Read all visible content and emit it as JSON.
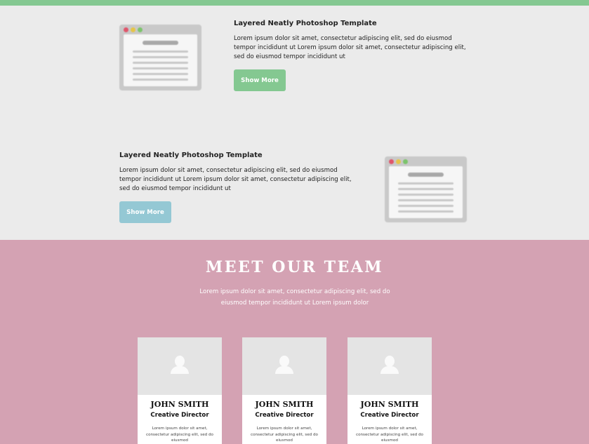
{
  "features": [
    {
      "title": "Layered Neatly Photoshop Template",
      "body": "Lorem ipsum dolor sit amet, consectetur adipiscing elit, sed do eiusmod tempor incididunt ut Lorem ipsum dolor sit amet, consectetur adipiscing elit, sed do eiusmod tempor incididunt ut",
      "button_label": "Show More",
      "button_color": "#84c891"
    },
    {
      "title": "Layered Neatly Photoshop Template",
      "body": "Lorem ipsum dolor sit amet, consectetur adipiscing elit, sed do eiusmod tempor incididunt ut Lorem ipsum dolor sit amet, consectetur adipiscing elit, sed do eiusmod tempor incididunt ut",
      "button_label": "Show More",
      "button_color": "#94c8d4"
    }
  ],
  "team": {
    "heading": "MEET OUR TEAM",
    "subtitle": "Lorem ipsum dolor sit amet, consectetur adipiscing elit, sed do eiusmod tempor incididunt ut Lorem ipsum dolor",
    "members": [
      {
        "name": "JOHN SMITH",
        "role": "Creative Director",
        "bio": "Lorem ipsum dolor sit amet, consectetur adipiscing elit, sed do eiusmod"
      },
      {
        "name": "JOHN SMITH",
        "role": "Creative Director",
        "bio": "Lorem ipsum dolor sit amet, consectetur adipiscing elit, sed do eiusmod"
      },
      {
        "name": "JOHN SMITH",
        "role": "Creative Director",
        "bio": "Lorem ipsum dolor sit amet, consectetur adipiscing elit, sed do eiusmod"
      }
    ]
  },
  "colors": {
    "accent_green": "#84c891",
    "accent_blue": "#94c8d4",
    "team_background": "#d4a2b3",
    "section_background": "#ebebeb"
  },
  "icons": [
    "browser-window-icon",
    "user-avatar-icon"
  ]
}
